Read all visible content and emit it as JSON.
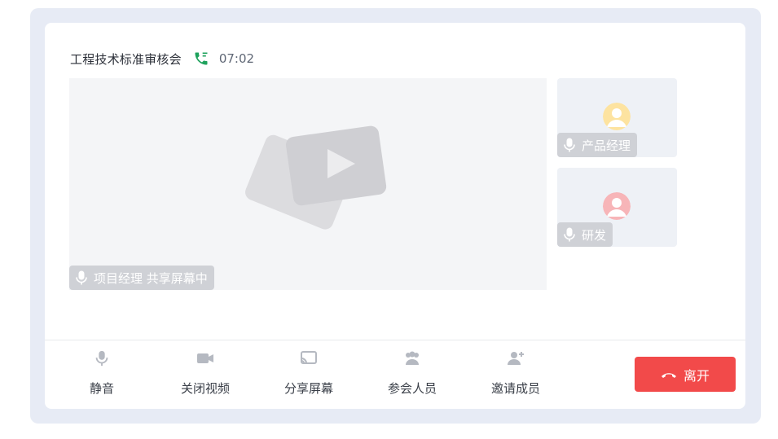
{
  "meeting": {
    "title": "工程技术标准审核会",
    "duration": "07:02",
    "call_icon": "phone-icon",
    "call_color": "#1fa25d"
  },
  "main_stream": {
    "label": "项目经理 共享屏幕中",
    "icon": "microphone-icon"
  },
  "participants": [
    {
      "label": "产品经理",
      "icon": "microphone-icon",
      "avatar_color": "#fde3a0"
    },
    {
      "label": "研发",
      "icon": "microphone-icon",
      "avatar_color": "#f7b5b8"
    }
  ],
  "toolbar": {
    "mute": "静音",
    "close_video": "关闭视频",
    "share_screen": "分享屏幕",
    "participants": "参会人员",
    "invite": "邀请成员",
    "leave": "离开"
  },
  "colors": {
    "leave_button": "#f24a4a",
    "frame": "#e7ebf5"
  }
}
